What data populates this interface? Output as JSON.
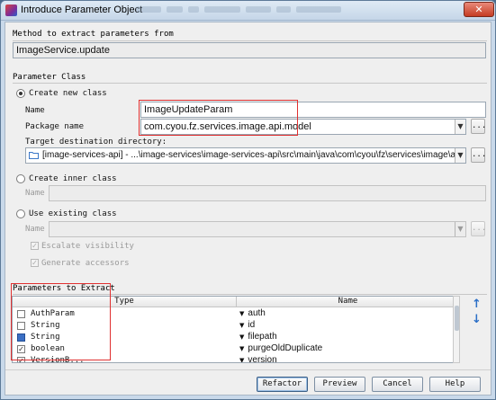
{
  "window": {
    "title": "Introduce Parameter Object",
    "close_glyph": "✕"
  },
  "method_section": {
    "label": "Method to extract parameters from",
    "value": "ImageService.update"
  },
  "parameter_class": {
    "label": "Parameter Class",
    "create_new": {
      "label": "Create new class",
      "selected": true,
      "name_label": "Name",
      "name_value": "ImageUpdateParam",
      "package_label": "Package name",
      "package_value": "com.cyou.fz.services.image.api.model",
      "target_label": "Target destination directory:",
      "target_value": "[image-services-api] - ...\\image-services\\image-services-api\\src\\main\\java\\com\\cyou\\fz\\services\\image\\api\\model"
    },
    "create_inner": {
      "label": "Create inner class",
      "name_label": "Name",
      "name_value": ""
    },
    "use_existing": {
      "label": "Use existing class",
      "name_label": "Name",
      "name_value": "",
      "escalate_label": "Escalate visibility",
      "generate_label": "Generate accessors"
    }
  },
  "params_section": {
    "label": "Parameters to Extract",
    "columns": [
      "Type",
      "Name"
    ],
    "rows": [
      {
        "checked": false,
        "type": "AuthParam",
        "name": "auth"
      },
      {
        "checked": false,
        "type": "String",
        "name": "id"
      },
      {
        "checked": true,
        "type": "String",
        "name": "filepath"
      },
      {
        "checked": true,
        "type": "boolean",
        "name": "purgeOldDuplicate"
      },
      {
        "checked": true,
        "type": "VersionB...",
        "name": "version"
      }
    ]
  },
  "buttons": {
    "browse": "...",
    "refactor": "Refactor",
    "preview": "Preview",
    "cancel": "Cancel",
    "help": "Help"
  },
  "icons": {
    "move_up": "up-arrow-icon",
    "move_down": "down-arrow-icon",
    "folder": "folder-icon"
  },
  "colors": {
    "highlight_box": "#e03030",
    "arrow_blue": "#2b6fc7"
  }
}
